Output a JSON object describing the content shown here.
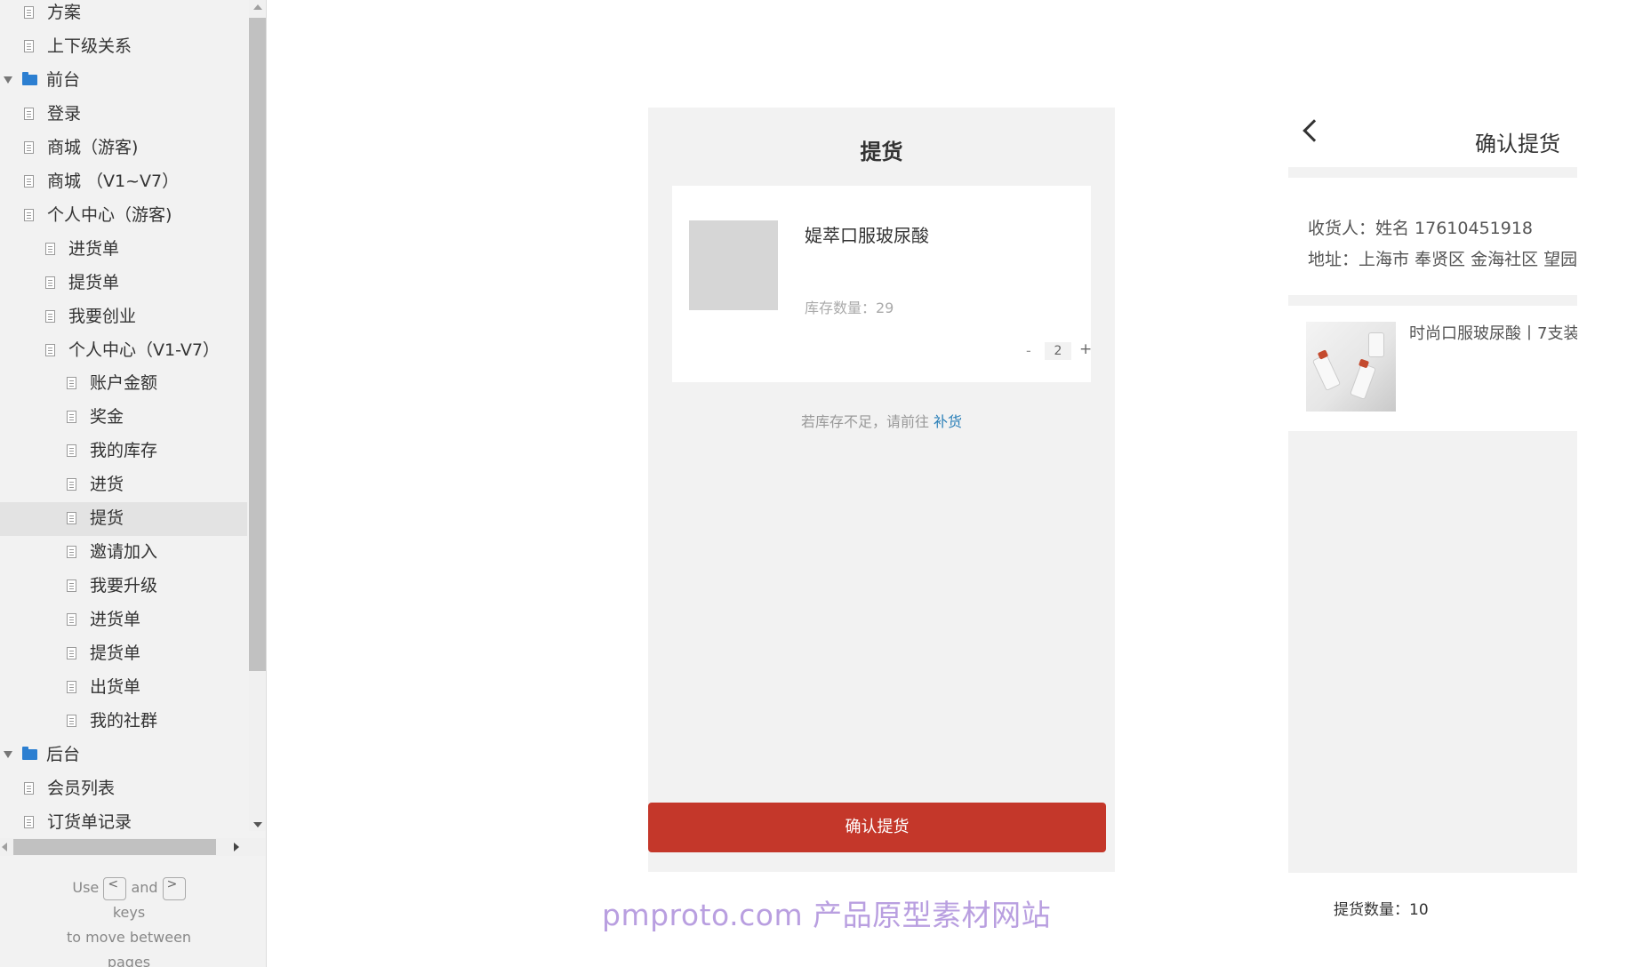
{
  "sidebar": {
    "items": [
      {
        "label": "方案",
        "type": "page"
      },
      {
        "label": "上下级关系",
        "type": "page"
      },
      {
        "label": "前台",
        "type": "folder"
      },
      {
        "label": "登录",
        "type": "page"
      },
      {
        "label": "商城（游客)",
        "type": "page"
      },
      {
        "label": "商城 （V1~V7）",
        "type": "page"
      },
      {
        "label": "个人中心（游客)",
        "type": "page"
      },
      {
        "label": "进货单",
        "type": "page"
      },
      {
        "label": "提货单",
        "type": "page"
      },
      {
        "label": "我要创业",
        "type": "page"
      },
      {
        "label": "个人中心（V1-V7）",
        "type": "page"
      },
      {
        "label": "账户金额",
        "type": "page"
      },
      {
        "label": "奖金",
        "type": "page"
      },
      {
        "label": "我的库存",
        "type": "page"
      },
      {
        "label": "进货",
        "type": "page"
      },
      {
        "label": "提货",
        "type": "page",
        "selected": true
      },
      {
        "label": "邀请加入",
        "type": "page"
      },
      {
        "label": "我要升级",
        "type": "page"
      },
      {
        "label": "进货单",
        "type": "page"
      },
      {
        "label": "提货单",
        "type": "page"
      },
      {
        "label": "出货单",
        "type": "page"
      },
      {
        "label": "我的社群",
        "type": "page"
      },
      {
        "label": "后台",
        "type": "folder"
      },
      {
        "label": "会员列表",
        "type": "page"
      },
      {
        "label": "订货单记录",
        "type": "page"
      }
    ],
    "hint": {
      "use": "Use",
      "prev_key": "<",
      "and": "and",
      "next_key": ">",
      "keys": "keys",
      "to_move": "to move between",
      "pages": "pages"
    }
  },
  "phone1": {
    "title": "提货",
    "product_name": "媞萃口服玻尿酸",
    "stock": "库存数量：29",
    "minus": "-",
    "quantity": "2",
    "plus": "+",
    "note": "若库存不足，请前往",
    "note_link": "补货",
    "confirm_button": "确认提货",
    "accent_color": "#c4372a"
  },
  "phone2": {
    "title": "确认提货",
    "receiver": "收货人：姓名 17610451918",
    "address": "地址：上海市 奉贤区 金海社区 望园",
    "product_name": "时尚口服玻尿酸丨7支装",
    "pickup_quantity": "提货数量：10"
  },
  "watermark": "pmproto.com 产品原型素材网站"
}
